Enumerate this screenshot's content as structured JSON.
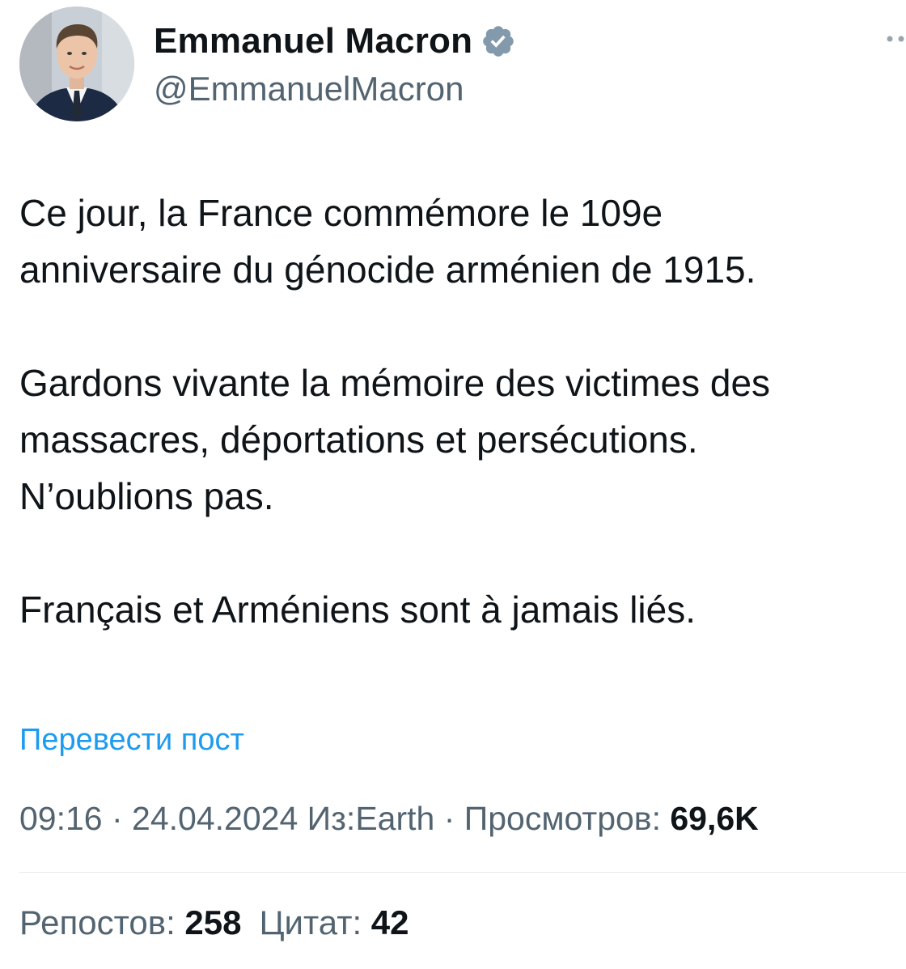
{
  "author": {
    "display_name": "Emmanuel Macron",
    "handle": "@EmmanuelMacron",
    "verified": true
  },
  "post": {
    "paragraphs": [
      "Ce jour, la France commémore le 109e\nanniversaire du génocide arménien de 1915.",
      "Gardons vivante la mémoire des victimes des\nmassacres, déportations et persécutions.\nN’oublions pas.",
      "Français et Arméniens sont à jamais liés."
    ],
    "translate_label": "Перевести пост"
  },
  "meta": {
    "time": "09:16",
    "separator": " · ",
    "date": "24.04.2024",
    "source": "Из:Earth",
    "views_label": "Просмотров: ",
    "views_count": "69,6K"
  },
  "stats": {
    "reposts_label": "Репостов: ",
    "reposts_count": "258",
    "quotes_label": "Цитат: ",
    "quotes_count": "42"
  },
  "colors": {
    "text": "#0f1419",
    "secondary": "#536471",
    "link": "#1d9bf0",
    "verified_badge": "#829aab",
    "divider": "#e6e9eb"
  },
  "icons": {
    "verified": "verified-badge-icon",
    "more": "more-options-icon"
  }
}
